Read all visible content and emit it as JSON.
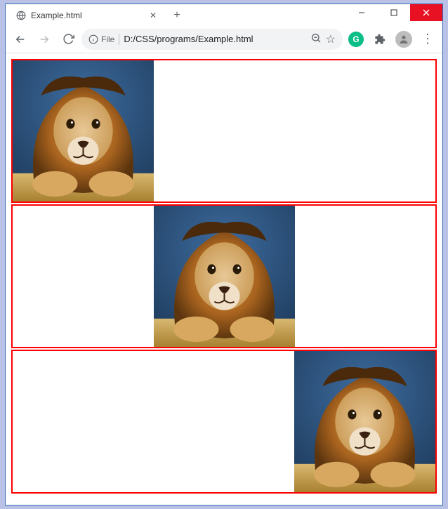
{
  "window": {
    "minimize": "—",
    "maximize": "□",
    "close": "✕"
  },
  "tab": {
    "title": "Example.html",
    "close": "✕",
    "new_tab": "+"
  },
  "toolbar": {
    "back": "←",
    "forward": "→",
    "reload": "⟳",
    "file_label": "File",
    "url": "D:/CSS/programs/Example.html",
    "zoom": "⊝",
    "bookmark": "☆",
    "menu": "⋮"
  },
  "content": {
    "boxes": [
      "left",
      "center",
      "right"
    ]
  }
}
